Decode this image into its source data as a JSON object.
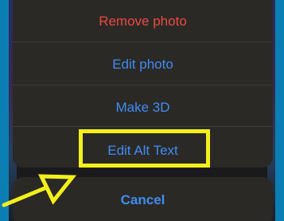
{
  "action_sheet": {
    "remove_photo_label": "Remove photo",
    "edit_photo_label": "Edit photo",
    "make_3d_label": "Make 3D",
    "edit_alt_text_label": "Edit Alt Text",
    "cancel_label": "Cancel"
  },
  "colors": {
    "background_accent": "#0b7fb3",
    "sheet": "#2b2926",
    "action_blue": "#3f8cf3",
    "destructive_red": "#eb4a42",
    "highlight_yellow": "#f3f01a"
  },
  "icons": [
    "annotation-arrow-icon"
  ]
}
